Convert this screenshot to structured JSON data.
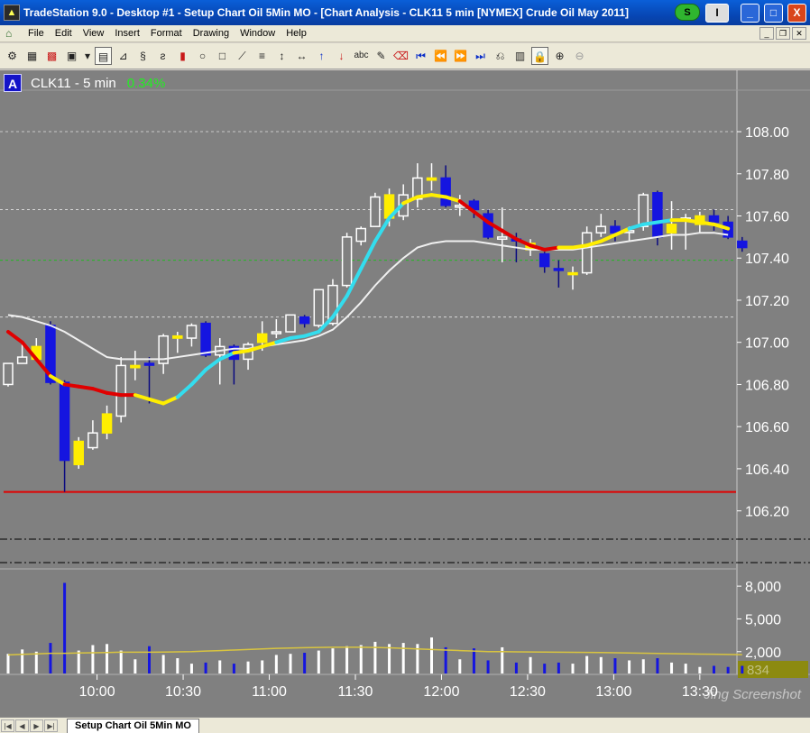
{
  "window": {
    "title": "TradeStation 9.0 - Desktop #1 - Setup Chart Oil 5Min MO - [Chart Analysis - CLK11 5 min [NYMEX] Crude Oil May 2011]",
    "status_badge": "S",
    "dropdown_label": "I",
    "minimize": "_",
    "maximize": "□",
    "close": "X"
  },
  "menu": {
    "items": [
      "File",
      "Edit",
      "View",
      "Insert",
      "Format",
      "Drawing",
      "Window",
      "Help"
    ]
  },
  "toolbar": {
    "icons": [
      "chart-settings-icon",
      "bar-chart-icon",
      "candle-chart-icon",
      "grid-chart-icon",
      "dropdown-icon",
      "bar-style-icon",
      "line-style-icon",
      "point-figure-icon",
      "kagi-icon",
      "candle-icon",
      "ellipse-icon",
      "rectangle-icon",
      "trendline-icon",
      "horizontal-line-icon",
      "vertical-line-icon",
      "horizontal-arrows-icon",
      "arrow-up-icon",
      "arrow-down-icon",
      "text-icon",
      "pencil-icon",
      "eraser-icon",
      "go-first-icon",
      "scroll-left-icon",
      "scroll-right-icon",
      "go-last-icon",
      "zoom-back-icon",
      "data-window-icon",
      "lock-icon",
      "zoom-in-icon",
      "zoom-out-icon"
    ]
  },
  "chart": {
    "badge": "A",
    "symbol_label": "CLK11 - 5 min",
    "change_pct": "0.34%",
    "volume_last": "834",
    "tab_label": "Setup Chart Oil 5Min MO",
    "watermark": "Jing Screenshot"
  },
  "colors": {
    "background": "#808080",
    "up_candle": "#ffffff",
    "down_candle": "#1515e0",
    "neutral_candle": "#ffee00",
    "ma_red": "#e00000",
    "ma_yellow": "#ffee00",
    "ma_cyan": "#33ddee",
    "ma_slow": "#f0f0f0",
    "support_line": "#e00000",
    "volume_avg": "#d8c440"
  },
  "chart_data": {
    "type": "candlestick",
    "price_axis": {
      "ticks": [
        "108.00",
        "107.80",
        "107.60",
        "107.40",
        "107.20",
        "107.00",
        "106.80",
        "106.60",
        "106.40",
        "106.20"
      ],
      "range": [
        106.1,
        108.12
      ]
    },
    "volume_axis": {
      "ticks": [
        "8,000",
        "5,000",
        "2,000"
      ],
      "range": [
        0,
        9000
      ]
    },
    "time_axis": {
      "ticks": [
        "10:00",
        "10:30",
        "11:00",
        "11:30",
        "12:00",
        "12:30",
        "13:00",
        "13:30"
      ]
    },
    "support_level": 106.29,
    "reference_lines": [
      107.63,
      107.39,
      107.12,
      108.0
    ],
    "candles": [
      {
        "o": 106.8,
        "h": 106.9,
        "l": 106.79,
        "c": 106.9,
        "c_": "up",
        "v": 1800
      },
      {
        "o": 106.9,
        "h": 107.0,
        "l": 106.92,
        "c": 106.93,
        "c_": "up",
        "v": 2200
      },
      {
        "o": 106.92,
        "h": 107.02,
        "l": 106.92,
        "c": 106.98,
        "c_": "neutral",
        "v": 2000
      },
      {
        "o": 107.08,
        "h": 107.1,
        "l": 106.8,
        "c": 106.81,
        "c_": "down",
        "v": 2800
      },
      {
        "o": 106.81,
        "h": 106.82,
        "l": 106.29,
        "c": 106.44,
        "c_": "down",
        "v": 8300
      },
      {
        "o": 106.42,
        "h": 106.55,
        "l": 106.4,
        "c": 106.53,
        "c_": "neutral",
        "v": 2100
      },
      {
        "o": 106.5,
        "h": 106.63,
        "l": 106.49,
        "c": 106.57,
        "c_": "up",
        "v": 2600
      },
      {
        "o": 106.57,
        "h": 106.7,
        "l": 106.54,
        "c": 106.66,
        "c_": "neutral",
        "v": 2700
      },
      {
        "o": 106.65,
        "h": 106.93,
        "l": 106.62,
        "c": 106.89,
        "c_": "up",
        "v": 2100
      },
      {
        "o": 106.89,
        "h": 106.96,
        "l": 106.82,
        "c": 106.88,
        "c_": "neutral",
        "v": 1300
      },
      {
        "o": 106.9,
        "h": 106.93,
        "l": 106.71,
        "c": 106.9,
        "c_": "down",
        "v": 2500
      },
      {
        "o": 106.9,
        "h": 107.04,
        "l": 106.85,
        "c": 107.03,
        "c_": "up",
        "v": 1700
      },
      {
        "o": 107.02,
        "h": 107.05,
        "l": 106.95,
        "c": 107.03,
        "c_": "neutral",
        "v": 1400
      },
      {
        "o": 107.02,
        "h": 107.09,
        "l": 106.98,
        "c": 107.08,
        "c_": "up",
        "v": 900
      },
      {
        "o": 107.09,
        "h": 107.1,
        "l": 106.93,
        "c": 106.94,
        "c_": "down",
        "v": 1000
      },
      {
        "o": 106.94,
        "h": 107.02,
        "l": 106.8,
        "c": 106.98,
        "c_": "up",
        "v": 1200
      },
      {
        "o": 106.98,
        "h": 106.99,
        "l": 106.8,
        "c": 106.92,
        "c_": "down",
        "v": 900
      },
      {
        "o": 106.92,
        "h": 107.0,
        "l": 106.87,
        "c": 106.99,
        "c_": "up",
        "v": 1100
      },
      {
        "o": 107.0,
        "h": 107.1,
        "l": 106.96,
        "c": 107.04,
        "c_": "neutral",
        "v": 1200
      },
      {
        "o": 107.05,
        "h": 107.11,
        "l": 107.02,
        "c": 107.05,
        "c_": "up",
        "v": 1700
      },
      {
        "o": 107.05,
        "h": 107.13,
        "l": 107.05,
        "c": 107.13,
        "c_": "up",
        "v": 1800
      },
      {
        "o": 107.12,
        "h": 107.13,
        "l": 107.07,
        "c": 107.09,
        "c_": "down",
        "v": 1900
      },
      {
        "o": 107.08,
        "h": 107.25,
        "l": 107.07,
        "c": 107.25,
        "c_": "up",
        "v": 2100
      },
      {
        "o": 107.09,
        "h": 107.3,
        "l": 107.08,
        "c": 107.27,
        "c_": "up",
        "v": 2300
      },
      {
        "o": 107.27,
        "h": 107.52,
        "l": 107.26,
        "c": 107.5,
        "c_": "up",
        "v": 2500
      },
      {
        "o": 107.48,
        "h": 107.55,
        "l": 107.46,
        "c": 107.54,
        "c_": "up",
        "v": 2600
      },
      {
        "o": 107.55,
        "h": 107.71,
        "l": 107.55,
        "c": 107.69,
        "c_": "up",
        "v": 2900
      },
      {
        "o": 107.7,
        "h": 107.73,
        "l": 107.55,
        "c": 107.59,
        "c_": "neutral",
        "v": 2700
      },
      {
        "o": 107.6,
        "h": 107.75,
        "l": 107.58,
        "c": 107.7,
        "c_": "up",
        "v": 2800
      },
      {
        "o": 107.68,
        "h": 107.85,
        "l": 107.64,
        "c": 107.78,
        "c_": "up",
        "v": 2700
      },
      {
        "o": 107.78,
        "h": 107.85,
        "l": 107.72,
        "c": 107.77,
        "c_": "neutral",
        "v": 3300
      },
      {
        "o": 107.78,
        "h": 107.84,
        "l": 107.64,
        "c": 107.65,
        "c_": "down",
        "v": 2400
      },
      {
        "o": 107.65,
        "h": 107.7,
        "l": 107.6,
        "c": 107.65,
        "c_": "up",
        "v": 1300
      },
      {
        "o": 107.67,
        "h": 107.68,
        "l": 107.59,
        "c": 107.63,
        "c_": "down",
        "v": 2300
      },
      {
        "o": 107.61,
        "h": 107.63,
        "l": 107.49,
        "c": 107.5,
        "c_": "down",
        "v": 1200
      },
      {
        "o": 107.5,
        "h": 107.64,
        "l": 107.38,
        "c": 107.49,
        "c_": "up",
        "v": 2400
      },
      {
        "o": 107.49,
        "h": 107.52,
        "l": 107.38,
        "c": 107.49,
        "c_": "down",
        "v": 1000
      },
      {
        "o": 107.47,
        "h": 107.49,
        "l": 107.41,
        "c": 107.44,
        "c_": "neutral",
        "v": 1500
      },
      {
        "o": 107.42,
        "h": 107.43,
        "l": 107.33,
        "c": 107.36,
        "c_": "down",
        "v": 900
      },
      {
        "o": 107.35,
        "h": 107.39,
        "l": 107.26,
        "c": 107.35,
        "c_": "down",
        "v": 1000
      },
      {
        "o": 107.33,
        "h": 107.36,
        "l": 107.25,
        "c": 107.33,
        "c_": "neutral",
        "v": 900
      },
      {
        "o": 107.33,
        "h": 107.55,
        "l": 107.32,
        "c": 107.52,
        "c_": "up",
        "v": 1600
      },
      {
        "o": 107.52,
        "h": 107.61,
        "l": 107.5,
        "c": 107.55,
        "c_": "up",
        "v": 1500
      },
      {
        "o": 107.55,
        "h": 107.58,
        "l": 107.48,
        "c": 107.52,
        "c_": "down",
        "v": 1400
      },
      {
        "o": 107.53,
        "h": 107.55,
        "l": 107.48,
        "c": 107.53,
        "c_": "up",
        "v": 1200
      },
      {
        "o": 107.55,
        "h": 107.71,
        "l": 107.53,
        "c": 107.7,
        "c_": "up",
        "v": 1300
      },
      {
        "o": 107.71,
        "h": 107.72,
        "l": 107.46,
        "c": 107.5,
        "c_": "down",
        "v": 1400
      },
      {
        "o": 107.52,
        "h": 107.67,
        "l": 107.44,
        "c": 107.56,
        "c_": "neutral",
        "v": 1000
      },
      {
        "o": 107.58,
        "h": 107.61,
        "l": 107.44,
        "c": 107.59,
        "c_": "up",
        "v": 900
      },
      {
        "o": 107.6,
        "h": 107.62,
        "l": 107.52,
        "c": 107.56,
        "c_": "neutral",
        "v": 600
      },
      {
        "o": 107.6,
        "h": 107.63,
        "l": 107.53,
        "c": 107.57,
        "c_": "down",
        "v": 700
      },
      {
        "o": 107.57,
        "h": 107.6,
        "l": 107.49,
        "c": 107.5,
        "c_": "down",
        "v": 600
      },
      {
        "o": 107.48,
        "h": 107.5,
        "l": 107.43,
        "c": 107.45,
        "c_": "down",
        "v": 700
      }
    ],
    "ma_fast": [
      107.05,
      107.0,
      106.92,
      106.84,
      106.8,
      106.79,
      106.78,
      106.76,
      106.75,
      106.75,
      106.73,
      106.71,
      106.74,
      106.8,
      106.87,
      106.92,
      106.95,
      106.96,
      106.98,
      107.0,
      107.02,
      107.03,
      107.05,
      107.12,
      107.22,
      107.35,
      107.48,
      107.59,
      107.66,
      107.69,
      107.7,
      107.69,
      107.67,
      107.62,
      107.57,
      107.53,
      107.49,
      107.46,
      107.44,
      107.45,
      107.45,
      107.46,
      107.48,
      107.51,
      107.54,
      107.56,
      107.57,
      107.58,
      107.58,
      107.57,
      107.56,
      107.54
    ],
    "ma_fast_colors": [
      "red",
      "red",
      "red",
      "yellow",
      "red",
      "red",
      "red",
      "red",
      "red",
      "yellow",
      "yellow",
      "yellow",
      "cyan",
      "cyan",
      "cyan",
      "cyan",
      "yellow",
      "yellow",
      "yellow",
      "cyan",
      "cyan",
      "cyan",
      "cyan",
      "cyan",
      "cyan",
      "cyan",
      "cyan",
      "cyan",
      "yellow",
      "yellow",
      "yellow",
      "yellow",
      "red",
      "red",
      "red",
      "red",
      "red",
      "red",
      "red",
      "yellow",
      "yellow",
      "yellow",
      "yellow",
      "yellow",
      "cyan",
      "cyan",
      "cyan",
      "yellow",
      "yellow",
      "yellow",
      "yellow",
      "red"
    ],
    "ma_slow": [
      107.13,
      107.12,
      107.1,
      107.08,
      107.05,
      107.01,
      106.97,
      106.93,
      106.92,
      106.92,
      106.92,
      106.92,
      106.93,
      106.94,
      106.95,
      106.96,
      106.97,
      106.97,
      106.98,
      106.99,
      107.0,
      107.01,
      107.03,
      107.06,
      107.12,
      107.19,
      107.27,
      107.34,
      107.4,
      107.45,
      107.47,
      107.48,
      107.48,
      107.48,
      107.47,
      107.46,
      107.45,
      107.44,
      107.44,
      107.44,
      107.44,
      107.45,
      107.46,
      107.47,
      107.48,
      107.49,
      107.5,
      107.51,
      107.51,
      107.52,
      107.52,
      107.51
    ],
    "vol_avg": [
      1700,
      1750,
      1800,
      1850,
      1850,
      1880,
      1900,
      1920,
      1950,
      1950,
      1950,
      1960,
      1980,
      2000,
      2050,
      2100,
      2150,
      2200,
      2250,
      2300,
      2330,
      2360,
      2380,
      2400,
      2400,
      2400,
      2380,
      2350,
      2300,
      2250,
      2200,
      2150,
      2100,
      2050,
      2000,
      2000,
      1980,
      1970,
      1960,
      1950,
      1940,
      1930,
      1920,
      1900,
      1880,
      1860,
      1840,
      1820,
      1800,
      1780,
      1760,
      1740,
      1720
    ]
  }
}
